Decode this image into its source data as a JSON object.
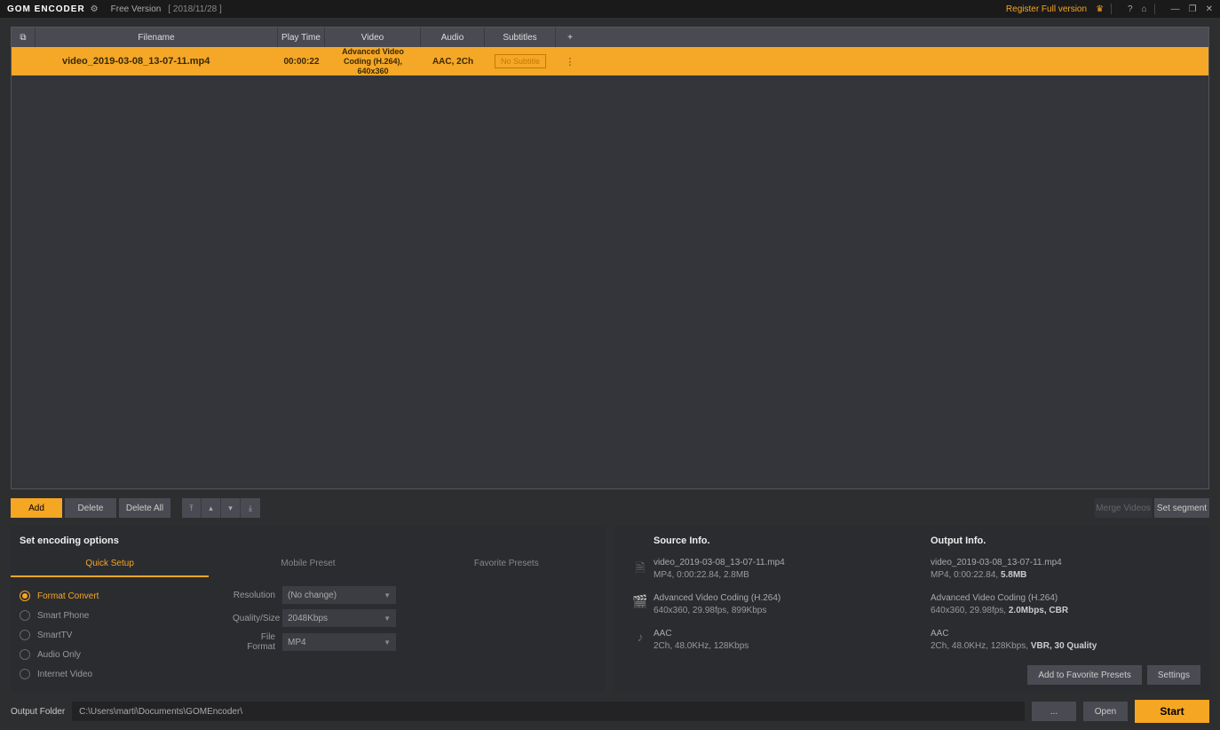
{
  "titlebar": {
    "app_name": "GOM ENCODER",
    "version": "Free Version",
    "date": "[ 2018/11/28 ]",
    "register": "Register Full version"
  },
  "table": {
    "headers": {
      "filename": "Filename",
      "playtime": "Play Time",
      "video": "Video",
      "audio": "Audio",
      "subtitles": "Subtitles",
      "plus": "+"
    },
    "rows": [
      {
        "filename": "video_2019-03-08_13-07-11.mp4",
        "playtime": "00:00:22",
        "video": "Advanced Video Coding (H.264), 640x360",
        "audio": "AAC, 2Ch",
        "subtitle": "No Subtitle"
      }
    ]
  },
  "actions": {
    "add": "Add",
    "delete": "Delete",
    "delete_all": "Delete All",
    "merge": "Merge Videos",
    "segment": "Set segment"
  },
  "encoding": {
    "title": "Set encoding options",
    "tabs": [
      "Quick Setup",
      "Mobile Preset",
      "Favorite Presets"
    ],
    "radios": [
      "Format Convert",
      "Smart Phone",
      "SmartTV",
      "Audio Only",
      "Internet Video"
    ],
    "opts": {
      "resolution_label": "Resolution",
      "resolution_value": "(No change)",
      "quality_label": "Quality/Size",
      "quality_value": "2048Kbps",
      "format_label": "File Format",
      "format_value": "MP4"
    }
  },
  "info": {
    "source_header": "Source Info.",
    "output_header": "Output Info.",
    "file_src_name": "video_2019-03-08_13-07-11.mp4",
    "file_src_detail": "MP4, 0:00:22.84, 2.8MB",
    "file_out_name": "video_2019-03-08_13-07-11.mp4",
    "file_out_detail_prefix": "MP4, 0:00:22.84, ",
    "file_out_detail_hl": "5.8MB",
    "video_src_name": "Advanced Video Coding (H.264)",
    "video_src_detail": "640x360, 29.98fps, 899Kbps",
    "video_out_name": "Advanced Video Coding (H.264)",
    "video_out_detail_prefix": "640x360, 29.98fps, ",
    "video_out_detail_hl": "2.0Mbps, CBR",
    "audio_src_name": "AAC",
    "audio_src_detail": "2Ch, 48.0KHz, 128Kbps",
    "audio_out_name": "AAC",
    "audio_out_detail_prefix": "2Ch, 48.0KHz, 128Kbps, ",
    "audio_out_detail_hl": "VBR, 30 Quality",
    "fav_btn": "Add to Favorite Presets",
    "settings_btn": "Settings"
  },
  "footer": {
    "label": "Output Folder",
    "path": "C:\\Users\\marti\\Documents\\GOMEncoder\\",
    "browse": "...",
    "open": "Open",
    "start": "Start"
  }
}
